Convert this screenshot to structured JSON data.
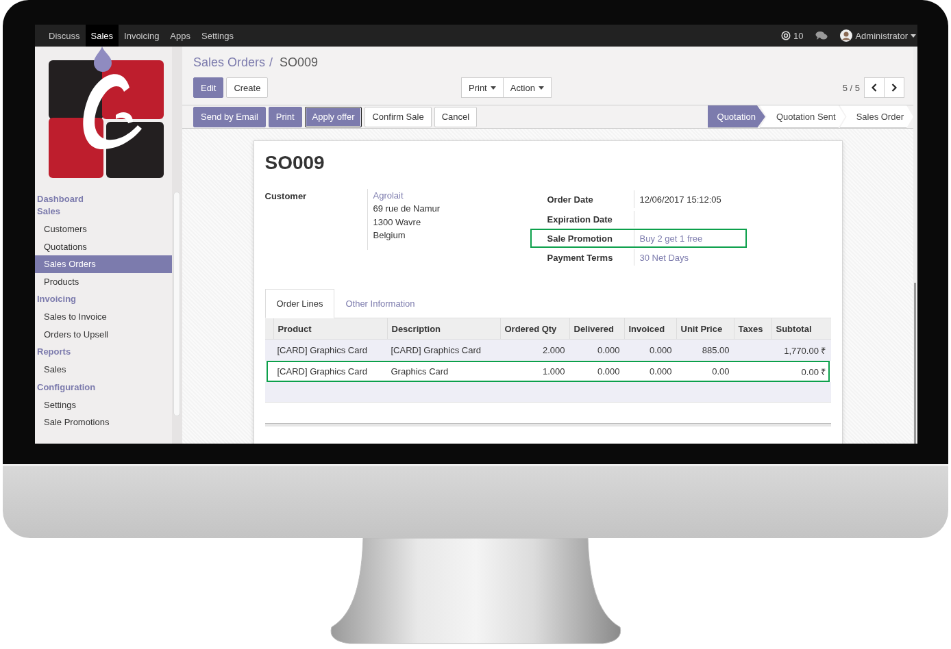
{
  "navbar": {
    "menu": [
      {
        "label": "Discuss",
        "selected": false
      },
      {
        "label": "Sales",
        "selected": true
      },
      {
        "label": "Invoicing",
        "selected": false
      },
      {
        "label": "Apps",
        "selected": false
      },
      {
        "label": "Settings",
        "selected": false
      }
    ],
    "mentions": "10",
    "user": "Administrator"
  },
  "sidebar": {
    "sections": [
      {
        "title": "Dashboard"
      },
      {
        "title": "Sales",
        "items": [
          {
            "label": "Customers",
            "selected": false
          },
          {
            "label": "Quotations",
            "selected": false
          },
          {
            "label": "Sales Orders",
            "selected": true
          },
          {
            "label": "Products",
            "selected": false
          }
        ]
      },
      {
        "title": "Invoicing",
        "items": [
          {
            "label": "Sales to Invoice",
            "selected": false
          },
          {
            "label": "Orders to Upsell",
            "selected": false
          }
        ]
      },
      {
        "title": "Reports",
        "items": [
          {
            "label": "Sales",
            "selected": false
          }
        ]
      },
      {
        "title": "Configuration",
        "items": [
          {
            "label": "Settings",
            "selected": false
          },
          {
            "label": "Sale Promotions",
            "selected": false
          }
        ]
      }
    ]
  },
  "breadcrumb": [
    "Sales Orders",
    "/",
    "SO009"
  ],
  "control_buttons": {
    "edit": "Edit",
    "create": "Create",
    "print": "Print",
    "action": "Action",
    "pager": "5 / 5"
  },
  "workflow_buttons": [
    {
      "label": "Send by Email",
      "kind": "primary"
    },
    {
      "label": "Print",
      "kind": "primary"
    },
    {
      "label": "Apply offer",
      "kind": "focused"
    },
    {
      "label": "Confirm Sale",
      "kind": "default"
    },
    {
      "label": "Cancel",
      "kind": "default"
    }
  ],
  "stages": [
    {
      "label": "Quotation",
      "selected": true
    },
    {
      "label": "Quotation Sent",
      "selected": false
    },
    {
      "label": "Sales Order",
      "selected": false
    }
  ],
  "sheet": {
    "title": "SO009",
    "customer": {
      "label": "Customer",
      "name": "Agrolait",
      "address": [
        "69 rue de Namur",
        "1300 Wavre",
        "Belgium"
      ]
    },
    "fields": [
      {
        "label": "Order Date",
        "value": "12/06/2017 15:12:05",
        "kind": "text",
        "highlighted": false
      },
      {
        "label": "Expiration Date",
        "highlighted": false
      },
      {
        "label": "Sale Promotion",
        "value": "Buy 2 get 1 free",
        "kind": "link",
        "highlighted": true
      },
      {
        "label": "Payment Terms",
        "value": "30 Net Days",
        "kind": "link",
        "highlighted": false
      }
    ],
    "tabs": [
      {
        "label": "Order Lines",
        "selected": true
      },
      {
        "label": "Other Information",
        "selected": false
      }
    ],
    "table": {
      "columns": [
        "Product",
        "Description",
        "Ordered Qty",
        "Delivered",
        "Invoiced",
        "Unit Price",
        "Taxes",
        "Subtotal"
      ],
      "rows": [
        {
          "cells": [
            "[CARD] Graphics Card",
            "[CARD] Graphics Card",
            "2.000",
            "0.000",
            "0.000",
            "885.00",
            "",
            "1,770.00 ₹"
          ],
          "highlighted": false
        },
        {
          "cells": [
            "[CARD] Graphics Card",
            "Graphics Card",
            "1.000",
            "0.000",
            "0.000",
            "0.00",
            "",
            "0.00 ₹"
          ],
          "highlighted": true
        }
      ]
    }
  }
}
